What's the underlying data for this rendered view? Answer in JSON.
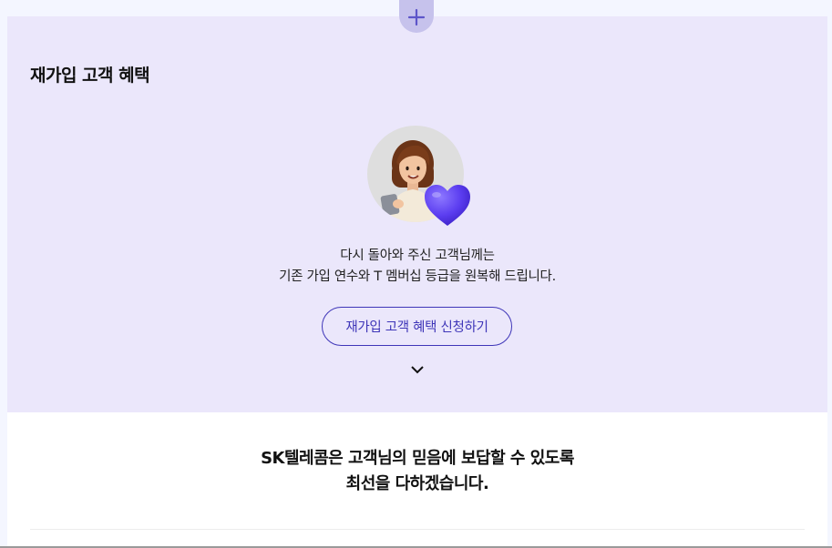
{
  "expand_button": {
    "icon": "plus-icon"
  },
  "benefit": {
    "title": "재가입 고객 혜택",
    "avatar_icon": "user-avatar-with-heart",
    "description_line1": "다시 돌아와 주신 고객님께는",
    "description_line2": "기존 가입 연수와 T 멤버십 등급을 원복해 드립니다.",
    "apply_button_label": "재가입 고객 혜택 신청하기",
    "toggle_icon": "chevron-down-icon"
  },
  "promise": {
    "line1": "SK텔레콤은 고객님의 믿음에 보답할 수 있도록",
    "line2": "최선을 다하겠습니다."
  },
  "colors": {
    "panel_bg": "#ebe7fb",
    "accent": "#3e35b8",
    "heart": "#5b3df0",
    "plus_bg": "#c6c2ec"
  }
}
